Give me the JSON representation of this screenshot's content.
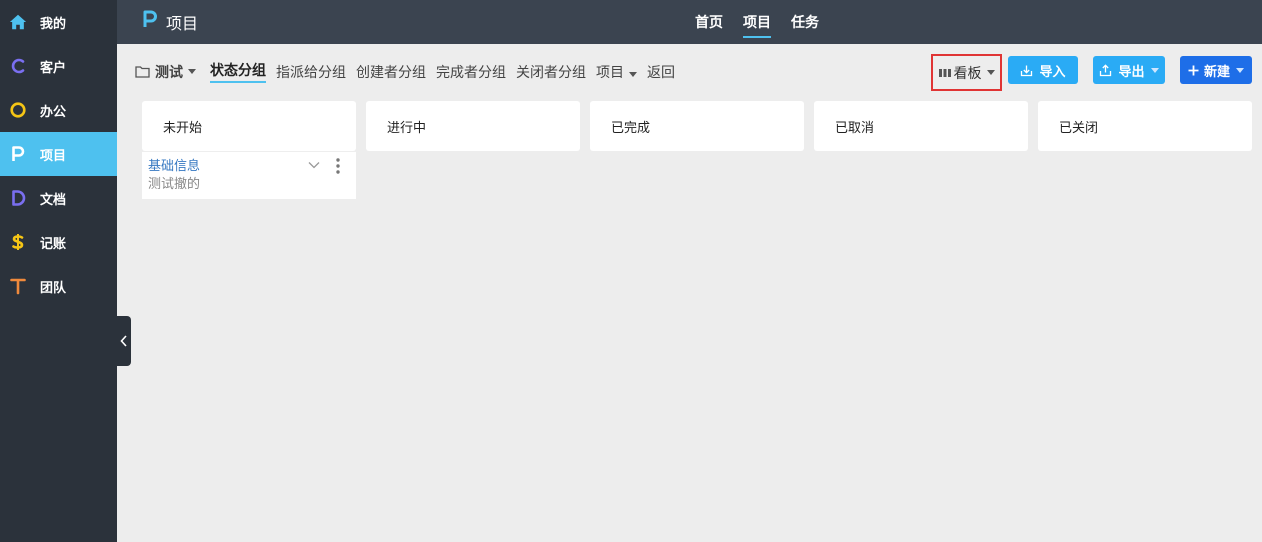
{
  "sidebar": {
    "items": [
      {
        "label": "我的",
        "icon": "home-icon",
        "color": "#4ec1ef"
      },
      {
        "label": "客户",
        "icon": "c-letter-icon",
        "color": "#7a6ff0"
      },
      {
        "label": "办公",
        "icon": "o-letter-icon",
        "color": "#f5c515"
      },
      {
        "label": "项目",
        "icon": "p-letter-icon",
        "color": "#ffffff"
      },
      {
        "label": "文档",
        "icon": "d-letter-icon",
        "color": "#7a6ff0"
      },
      {
        "label": "记账",
        "icon": "dollar-icon",
        "color": "#f5c515"
      },
      {
        "label": "团队",
        "icon": "t-letter-icon",
        "color": "#f08a3c"
      }
    ]
  },
  "topbar": {
    "title": "项目",
    "tabs": [
      {
        "label": "首页"
      },
      {
        "label": "项目"
      },
      {
        "label": "任务"
      }
    ]
  },
  "toolbar": {
    "breadcrumb": "测试",
    "groups": [
      {
        "label": "状态分组"
      },
      {
        "label": "指派给分组"
      },
      {
        "label": "创建者分组"
      },
      {
        "label": "完成者分组"
      },
      {
        "label": "关闭者分组"
      }
    ],
    "project_label": "项目",
    "back_label": "返回",
    "view_label": "看板",
    "import_label": "导入",
    "export_label": "导出",
    "new_label": "新建"
  },
  "board": {
    "columns": [
      {
        "title": "未开始"
      },
      {
        "title": "进行中"
      },
      {
        "title": "已完成"
      },
      {
        "title": "已取消"
      },
      {
        "title": "已关闭"
      }
    ],
    "cards": [
      {
        "title": "基础信息",
        "subtitle": "测试撤的"
      }
    ]
  }
}
